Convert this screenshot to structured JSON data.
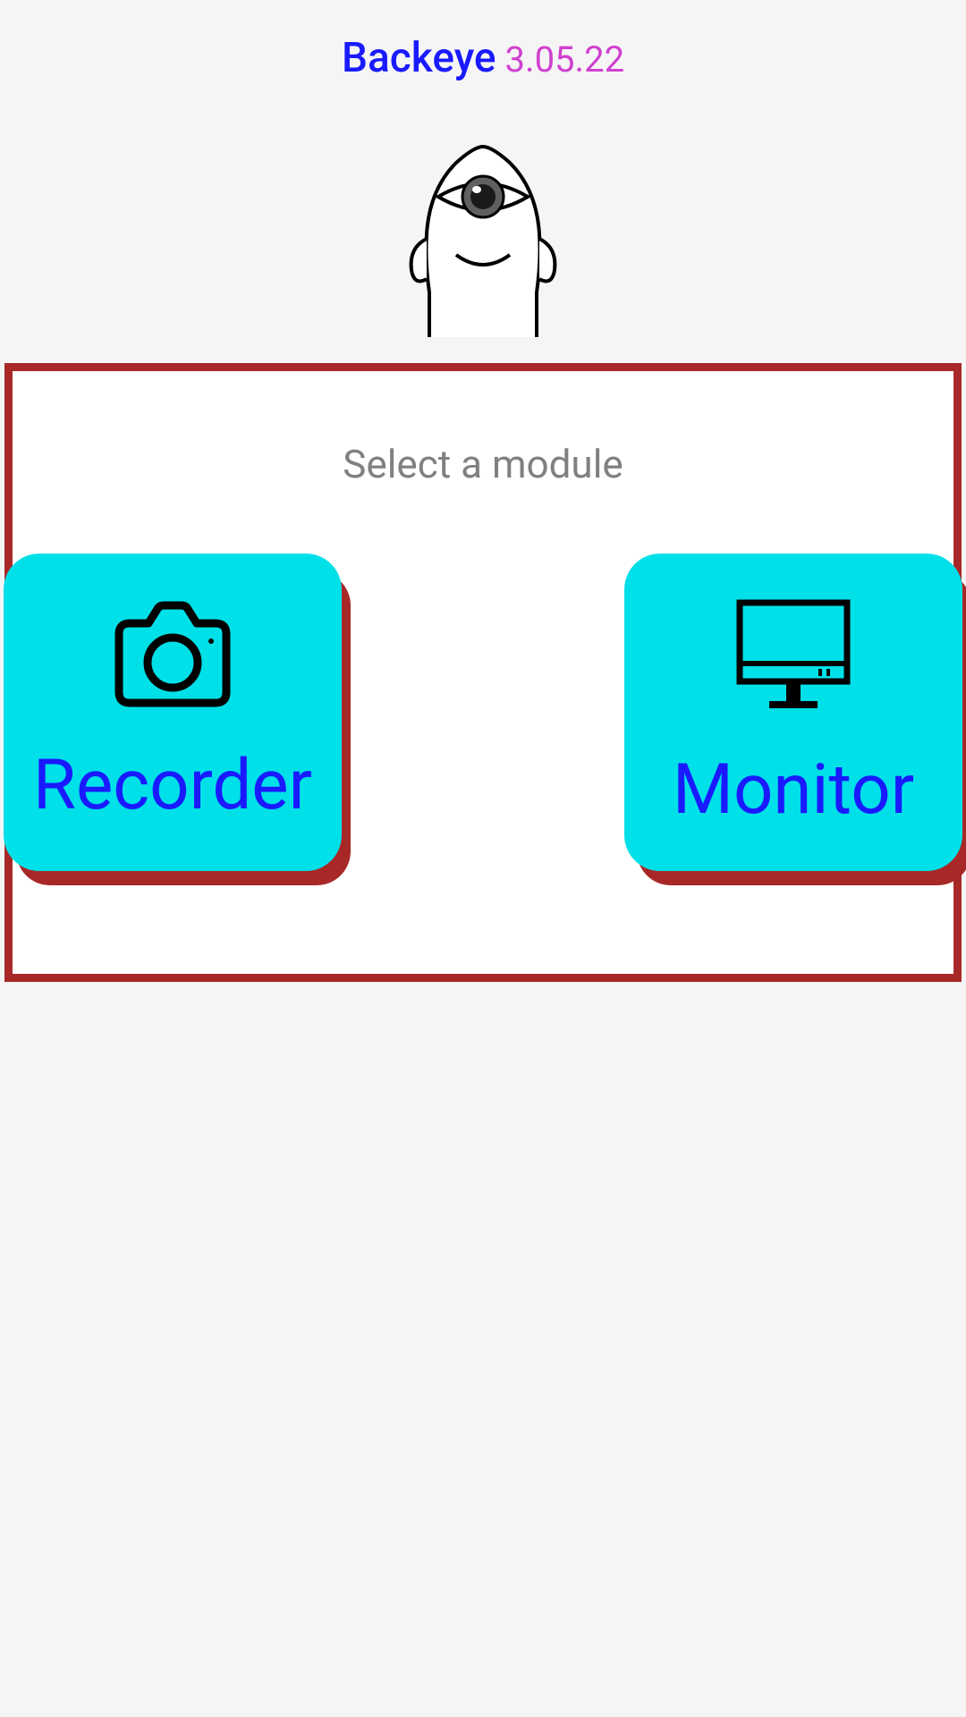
{
  "header": {
    "app_name": "Backeye",
    "app_version": "3.05.22"
  },
  "panel": {
    "title": "Select a module"
  },
  "modules": {
    "recorder": {
      "label": "Recorder",
      "icon": "camera-icon"
    },
    "monitor": {
      "label": "Monitor",
      "icon": "monitor-icon"
    }
  },
  "colors": {
    "accent_blue": "#1a1aff",
    "accent_magenta": "#d040d0",
    "button_cyan": "#00e0e8",
    "border_red": "#a82828",
    "text_gray": "#808080"
  }
}
